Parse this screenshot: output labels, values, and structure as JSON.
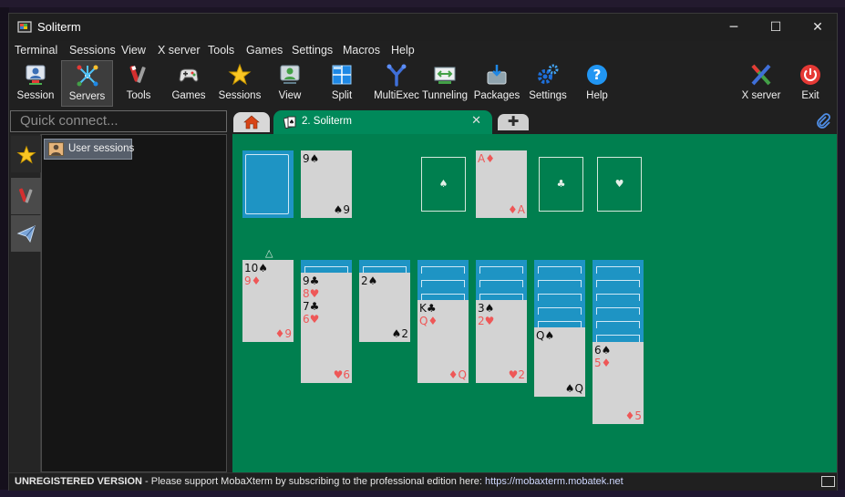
{
  "window": {
    "title": "Soliterm"
  },
  "window_controls": {
    "minimize": "─",
    "maximize": "☐",
    "close": "✕"
  },
  "menu": [
    "Terminal",
    "Sessions",
    "View",
    "X server",
    "Tools",
    "Games",
    "Settings",
    "Macros",
    "Help"
  ],
  "toolbar": [
    {
      "label": "Session",
      "icon": "session-icon"
    },
    {
      "label": "Servers",
      "icon": "servers-icon",
      "active": true
    },
    {
      "label": "Tools",
      "icon": "tools-icon"
    },
    {
      "label": "Games",
      "icon": "gamepad-icon"
    },
    {
      "label": "Sessions",
      "icon": "star-icon"
    },
    {
      "label": "View",
      "icon": "view-icon"
    },
    {
      "label": "Split",
      "icon": "split-icon"
    },
    {
      "label": "MultiExec",
      "icon": "multiexec-icon"
    },
    {
      "label": "Tunneling",
      "icon": "tunneling-icon"
    },
    {
      "label": "Packages",
      "icon": "packages-icon"
    },
    {
      "label": "Settings",
      "icon": "settings-icon"
    },
    {
      "label": "Help",
      "icon": "help-icon"
    },
    {
      "label": "X server",
      "icon": "xserver-icon"
    },
    {
      "label": "Exit",
      "icon": "power-icon"
    }
  ],
  "quick_connect": {
    "placeholder": "Quick connect..."
  },
  "tabs": {
    "active_label": "2. Soliterm",
    "close": "✕",
    "new": "✚"
  },
  "sidebar": {
    "user_sessions": "User sessions"
  },
  "game": {
    "recycle": "△",
    "waste": {
      "top": "9♠",
      "bottom": "♠9"
    },
    "foundations": [
      {
        "empty": "♠"
      },
      {
        "top": "A♦",
        "bottom": "♦A"
      },
      {
        "empty": "♣"
      },
      {
        "empty": "♥"
      }
    ],
    "tableau": [
      {
        "rows": [
          "10♠",
          "9♦"
        ],
        "bottom": "♦9"
      },
      {
        "rows": [
          "9♣",
          "8♥",
          "7♣",
          "6♥"
        ],
        "bottom": "♥6"
      },
      {
        "rows": [
          "2♠"
        ],
        "bottom": "♠2"
      },
      {
        "rows": [
          "K♣",
          "Q♦"
        ],
        "bottom": "♦Q"
      },
      {
        "rows": [
          "3♠",
          "2♥"
        ],
        "bottom": "♥2"
      },
      {
        "rows": [
          "Q♠"
        ],
        "bottom": "♠Q"
      },
      {
        "rows": [
          "6♠",
          "5♦"
        ],
        "bottom": "♦5"
      }
    ]
  },
  "status": {
    "label": "UNREGISTERED VERSION",
    "message": " -  Please support MobaXterm by subscribing to the professional edition here:  ",
    "link": "https://mobaxterm.mobatek.net"
  }
}
